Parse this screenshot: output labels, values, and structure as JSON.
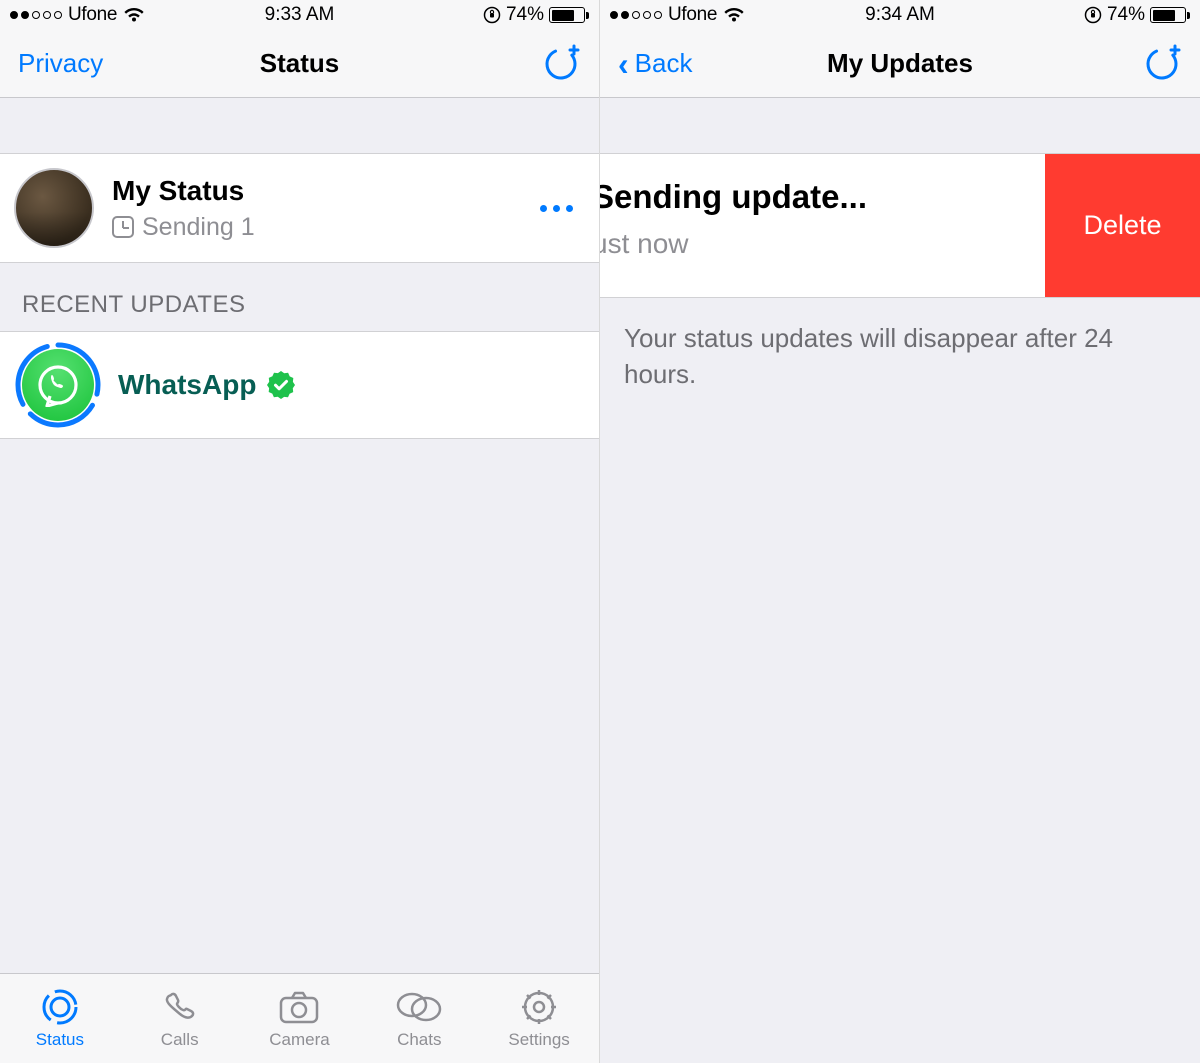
{
  "left": {
    "status_bar": {
      "carrier": "Ufone",
      "time": "9:33 AM",
      "battery": "74%",
      "battery_level": 0.74
    },
    "nav": {
      "left": "Privacy",
      "title": "Status"
    },
    "my_status": {
      "title": "My Status",
      "subtitle": "Sending 1"
    },
    "section": "RECENT UPDATES",
    "recent": {
      "name": "WhatsApp"
    },
    "tabs": [
      {
        "label": "Status",
        "icon": "status",
        "active": true
      },
      {
        "label": "Calls",
        "icon": "calls",
        "active": false
      },
      {
        "label": "Camera",
        "icon": "camera",
        "active": false
      },
      {
        "label": "Chats",
        "icon": "chats",
        "active": false
      },
      {
        "label": "Settings",
        "icon": "settings",
        "active": false
      }
    ]
  },
  "right": {
    "status_bar": {
      "carrier": "Ufone",
      "time": "9:34 AM",
      "battery": "74%",
      "battery_level": 0.74
    },
    "nav": {
      "back": "Back",
      "title": "My Updates"
    },
    "update": {
      "title_visible": "Sending update...",
      "subtitle_visible": "ust now",
      "delete": "Delete"
    },
    "footer": "Your status updates will disappear after 24 hours."
  }
}
